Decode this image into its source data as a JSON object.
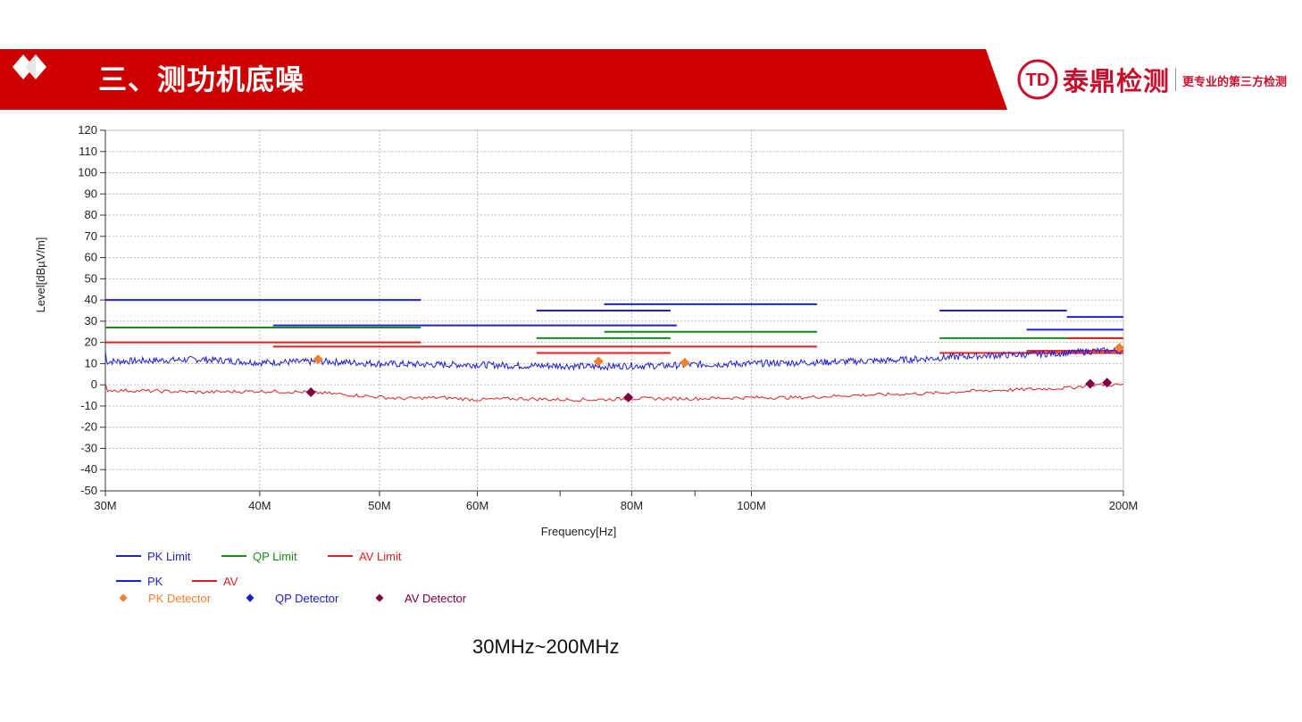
{
  "header": {
    "title": "三、测功机底噪",
    "banner_color": "#cc0000",
    "logo_name": "泰鼎检测",
    "logo_mark": "TD",
    "logo_slogan": "更专业的第三方检测",
    "icon": "double-diamond-icon"
  },
  "caption": "30MHz~200MHz",
  "chart_data": {
    "type": "line",
    "xlabel": "Frequency[Hz]",
    "ylabel": "Level[dBµV/m]",
    "x_scale": "log",
    "xlim": [
      30,
      200
    ],
    "ylim": [
      -50,
      120
    ],
    "grid": true,
    "x_ticks": [
      {
        "v": 30,
        "label": "30M"
      },
      {
        "v": 40,
        "label": "40M"
      },
      {
        "v": 50,
        "label": "50M"
      },
      {
        "v": 60,
        "label": "60M"
      },
      {
        "v": 70,
        "label": ""
      },
      {
        "v": 80,
        "label": "80M"
      },
      {
        "v": 90,
        "label": ""
      },
      {
        "v": 100,
        "label": "100M"
      },
      {
        "v": 200,
        "label": "200M"
      }
    ],
    "y_ticks": [
      120,
      110,
      100,
      90,
      80,
      70,
      60,
      50,
      40,
      30,
      20,
      10,
      0,
      -10,
      -20,
      -30,
      -40,
      -50
    ],
    "legend": [
      {
        "label": "PK Limit",
        "color": "#1f1fd6",
        "kind": "line"
      },
      {
        "label": "QP Limit",
        "color": "#1a8a1a",
        "kind": "line"
      },
      {
        "label": "AV Limit",
        "color": "#e02020",
        "kind": "line"
      },
      {
        "label": "PK",
        "color": "#1f1fd6",
        "kind": "line"
      },
      {
        "label": "AV",
        "color": "#e02020",
        "kind": "line"
      },
      {
        "label": "PK Detector",
        "color": "#f08030",
        "kind": "diamond"
      },
      {
        "label": "QP Detector",
        "color": "#1a1ad0",
        "kind": "diamond"
      },
      {
        "label": "AV Detector",
        "color": "#800040",
        "kind": "diamond"
      }
    ],
    "limit_segments": [
      {
        "series": "PK Limit",
        "color": "#1f1fd6",
        "x": [
          30,
          54
        ],
        "y": 40
      },
      {
        "series": "PK Limit",
        "color": "#1f1fd6",
        "x": [
          41,
          87
        ],
        "y": 28
      },
      {
        "series": "PK Limit",
        "color": "#1f1fd6",
        "x": [
          67,
          86
        ],
        "y": 35
      },
      {
        "series": "PK Limit",
        "color": "#1f1fd6",
        "x": [
          76,
          113
        ],
        "y": 38
      },
      {
        "series": "PK Limit",
        "color": "#1f1fd6",
        "x": [
          142,
          180
        ],
        "y": 35
      },
      {
        "series": "PK Limit",
        "color": "#1f1fd6",
        "x": [
          167,
          200
        ],
        "y": 26
      },
      {
        "series": "PK Limit",
        "color": "#1f1fd6",
        "x": [
          180,
          200
        ],
        "y": 32
      },
      {
        "series": "QP Limit",
        "color": "#1a8a1a",
        "x": [
          30,
          54
        ],
        "y": 27
      },
      {
        "series": "QP Limit",
        "color": "#1a8a1a",
        "x": [
          67,
          86
        ],
        "y": 22
      },
      {
        "series": "QP Limit",
        "color": "#1a8a1a",
        "x": [
          76,
          113
        ],
        "y": 25
      },
      {
        "series": "QP Limit",
        "color": "#1a8a1a",
        "x": [
          142,
          180
        ],
        "y": 22
      },
      {
        "series": "QP Limit",
        "color": "#1a8a1a",
        "x": [
          180,
          200
        ],
        "y": 22
      },
      {
        "series": "AV Limit",
        "color": "#e02020",
        "x": [
          30,
          54
        ],
        "y": 20
      },
      {
        "series": "AV Limit",
        "color": "#e02020",
        "x": [
          41,
          113
        ],
        "y": 18
      },
      {
        "series": "AV Limit",
        "color": "#e02020",
        "x": [
          67,
          86
        ],
        "y": 15
      },
      {
        "series": "AV Limit",
        "color": "#e02020",
        "x": [
          142,
          200
        ],
        "y": 15
      },
      {
        "series": "AV Limit",
        "color": "#e02020",
        "x": [
          167,
          200
        ],
        "y": 16
      },
      {
        "series": "AV Limit",
        "color": "#e02020",
        "x": [
          180,
          200
        ],
        "y": 22
      }
    ],
    "series": [
      {
        "name": "PK",
        "color": "#1f1fd6",
        "x": [
          30,
          33,
          36,
          40,
          45,
          50,
          55,
          60,
          65,
          70,
          75,
          80,
          85,
          90,
          100,
          110,
          120,
          130,
          140,
          150,
          160,
          170,
          180,
          190,
          200
        ],
        "y": [
          11,
          11.5,
          12,
          10.5,
          11,
          10,
          9.5,
          9.5,
          9,
          9,
          8.5,
          9,
          9,
          9.5,
          10,
          10.5,
          11,
          11.5,
          12.5,
          13.5,
          14,
          14.5,
          15,
          16,
          16
        ]
      },
      {
        "name": "AV",
        "color": "#e02020",
        "x": [
          30,
          33,
          36,
          40,
          44,
          48,
          52,
          56,
          60,
          65,
          70,
          75,
          80,
          85,
          90,
          100,
          110,
          120,
          130,
          140,
          150,
          160,
          170,
          180,
          190,
          200
        ],
        "y": [
          -2.5,
          -3,
          -3.5,
          -3,
          -3.5,
          -5,
          -6.5,
          -6,
          -7,
          -6.5,
          -7,
          -7,
          -6.5,
          -6.5,
          -6.5,
          -6,
          -6,
          -5,
          -4.5,
          -4,
          -3,
          -2.5,
          -2,
          -1.5,
          0,
          0
        ]
      }
    ],
    "markers": [
      {
        "series": "PK Detector",
        "color": "#f08030",
        "x": 44.6,
        "y": 12
      },
      {
        "series": "PK Detector",
        "color": "#f08030",
        "x": 75.2,
        "y": 11
      },
      {
        "series": "PK Detector",
        "color": "#f08030",
        "x": 88.3,
        "y": 10.5
      },
      {
        "series": "PK Detector",
        "color": "#f08030",
        "x": 198.5,
        "y": 17.5
      },
      {
        "series": "AV Detector",
        "color": "#800040",
        "x": 44.0,
        "y": -3.5
      },
      {
        "series": "AV Detector",
        "color": "#800040",
        "x": 79.5,
        "y": -6
      },
      {
        "series": "AV Detector",
        "color": "#800040",
        "x": 188,
        "y": 0.5
      },
      {
        "series": "AV Detector",
        "color": "#800040",
        "x": 194,
        "y": 1
      }
    ]
  }
}
